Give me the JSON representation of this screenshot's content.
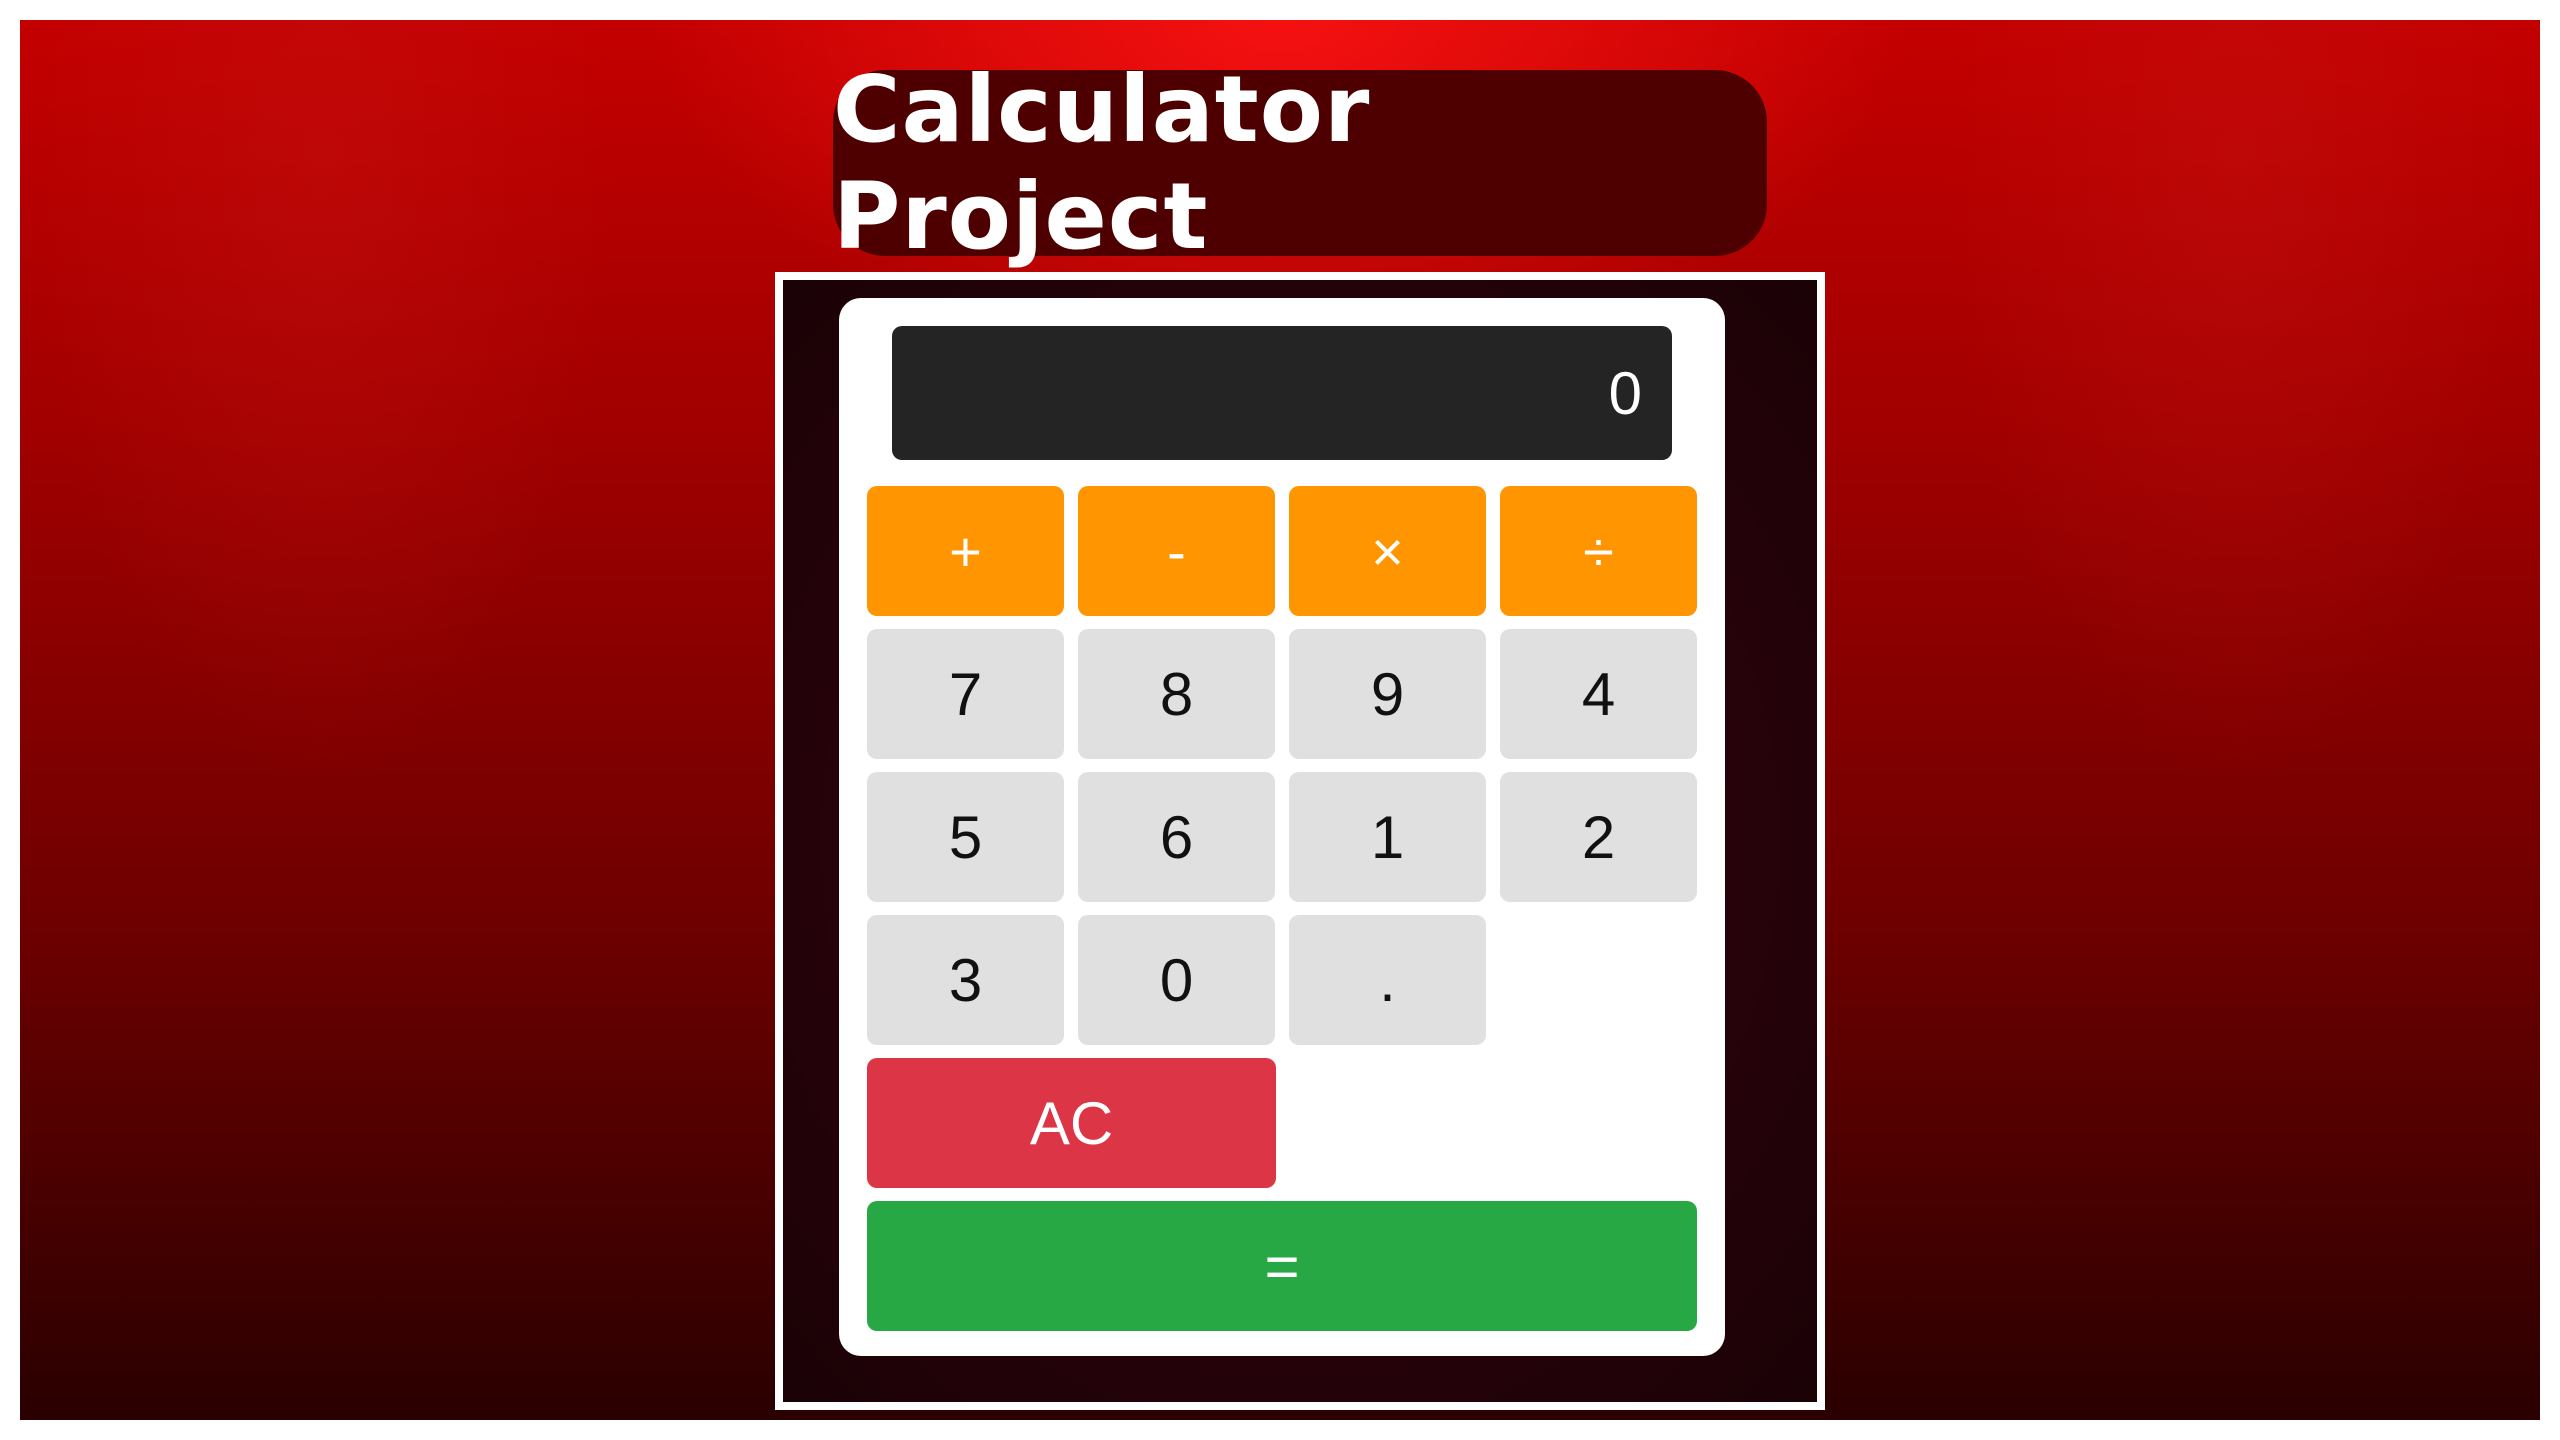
{
  "title": "Calculator Project",
  "display": {
    "value": "0"
  },
  "operators": {
    "add": "+",
    "subtract": "-",
    "multiply": "×",
    "divide": "÷"
  },
  "digits": {
    "seven": "7",
    "eight": "8",
    "nine": "9",
    "four": "4",
    "five": "5",
    "six": "6",
    "one": "1",
    "two": "2",
    "three": "3",
    "zero": "0",
    "decimal": "."
  },
  "controls": {
    "clear": "AC",
    "equals": "="
  },
  "colors": {
    "operator": "#ff9500",
    "number": "#e0e0e0",
    "clear": "#dc3545",
    "equals": "#28a745",
    "display": "#242424",
    "title_pill": "#4e0000"
  }
}
